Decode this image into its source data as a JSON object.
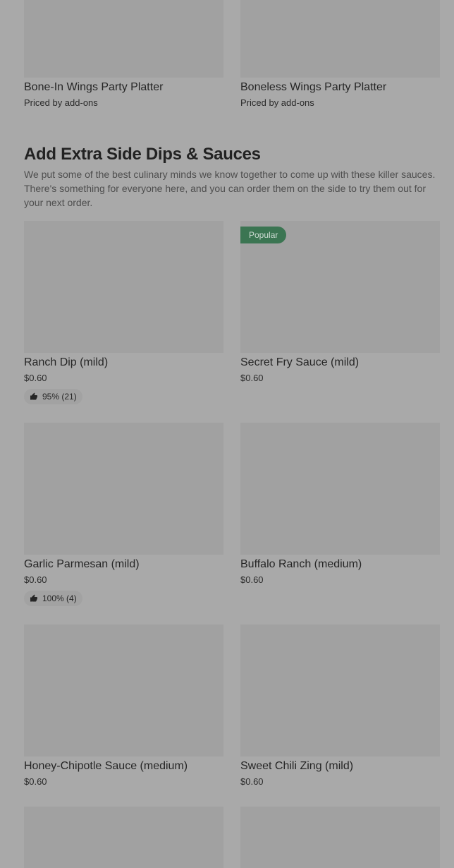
{
  "platters": [
    {
      "name": "Bone-In Wings Party Platter",
      "subtitle": "Priced by add-ons"
    },
    {
      "name": "Boneless Wings Party Platter",
      "subtitle": "Priced by add-ons"
    }
  ],
  "section": {
    "title": "Add Extra Side Dips & Sauces",
    "description": "We put some of the best culinary minds we know together to come up with these killer sauces. There's something for everyone here, and you can order them on the side to try them out for your next order."
  },
  "items": [
    {
      "name": "Ranch Dip (mild)",
      "price": "$0.60",
      "rating": "95% (21)"
    },
    {
      "name": "Secret Fry Sauce (mild)",
      "price": "$0.60",
      "badge": "Popular"
    },
    {
      "name": "Garlic Parmesan (mild)",
      "price": "$0.60",
      "rating": "100% (4)"
    },
    {
      "name": "Buffalo Ranch (medium)",
      "price": "$0.60"
    },
    {
      "name": "Honey-Chipotle Sauce (medium)",
      "price": "$0.60"
    },
    {
      "name": "Sweet Chili Zing (mild)",
      "price": "$0.60"
    }
  ],
  "icons": {
    "rating": "thumbs-up-icon"
  },
  "colors": {
    "popular_badge": "#3b7552",
    "overlay": "#a9a9a9"
  }
}
